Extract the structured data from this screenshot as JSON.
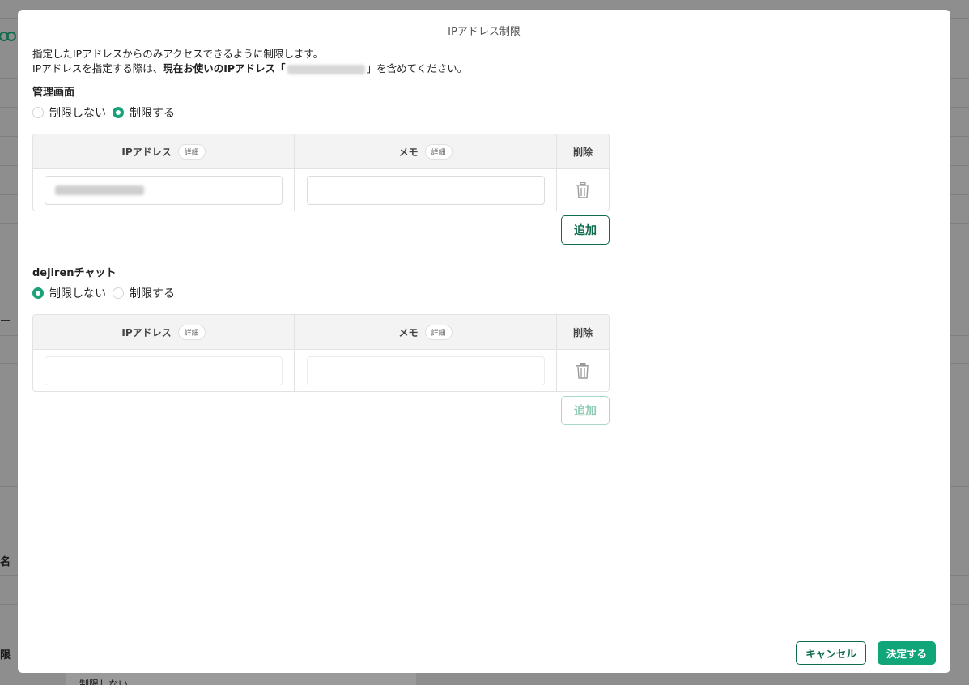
{
  "background": {
    "fragments": [
      "ー",
      "名",
      "限",
      "制限しない"
    ]
  },
  "modal": {
    "title": "IPアドレス制限",
    "desc_line1": "指定したIPアドレスからのみアクセスできるように制限します。",
    "desc_line2_prefix": "IPアドレスを指定する際は、",
    "desc_line2_bold": "現在お使いのIPアドレス「",
    "desc_line2_suffix": "」を含めてください。"
  },
  "admin": {
    "title": "管理画面",
    "radio_off_label": "制限しない",
    "radio_on_label": "制限する",
    "selected": "制限する",
    "headers": {
      "ip": "IPアドレス",
      "memo": "メモ",
      "delete": "削除",
      "detail": "詳細"
    },
    "add_label": "追加"
  },
  "chat": {
    "title": "dejirenチャット",
    "radio_off_label": "制限しない",
    "radio_on_label": "制限する",
    "selected": "制限しない",
    "headers": {
      "ip": "IPアドレス",
      "memo": "メモ",
      "delete": "削除",
      "detail": "詳細"
    },
    "add_label": "追加"
  },
  "footer": {
    "cancel_label": "キャンセル",
    "ok_label": "決定する"
  },
  "colors": {
    "accent": "#11a67a",
    "accent_dark": "#0f6b4d"
  }
}
